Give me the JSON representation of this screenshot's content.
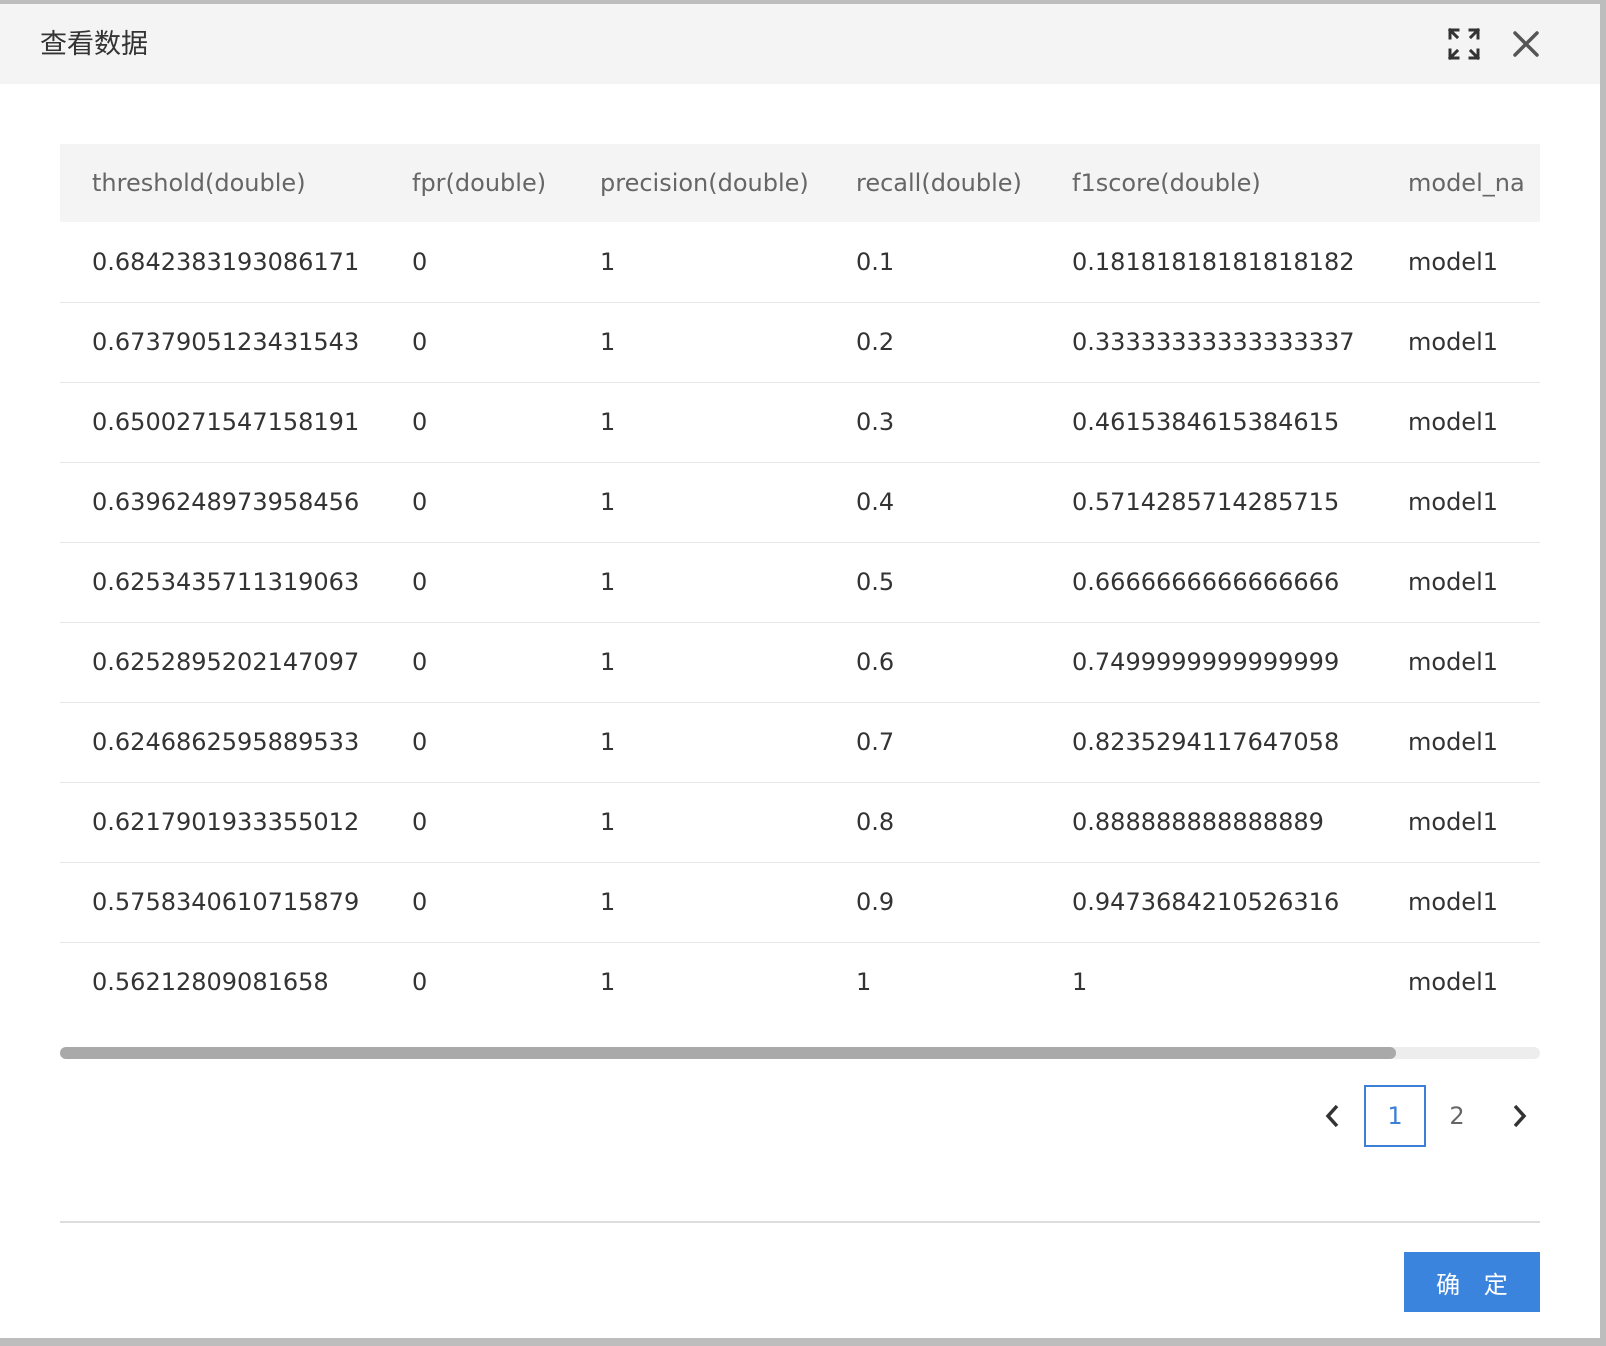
{
  "dialog": {
    "title": "查看数据",
    "confirm_label": "确 定"
  },
  "table": {
    "columns": [
      "threshold(double)",
      "fpr(double)",
      "precision(double)",
      "recall(double)",
      "f1score(double)",
      "model_na"
    ],
    "rows": [
      [
        "0.6842383193086171",
        "0",
        "1",
        "0.1",
        "0.18181818181818182",
        "model1"
      ],
      [
        "0.6737905123431543",
        "0",
        "1",
        "0.2",
        "0.33333333333333337",
        "model1"
      ],
      [
        "0.6500271547158191",
        "0",
        "1",
        "0.3",
        "0.4615384615384615",
        "model1"
      ],
      [
        "0.6396248973958456",
        "0",
        "1",
        "0.4",
        "0.5714285714285715",
        "model1"
      ],
      [
        "0.6253435711319063",
        "0",
        "1",
        "0.5",
        "0.6666666666666666",
        "model1"
      ],
      [
        "0.6252895202147097",
        "0",
        "1",
        "0.6",
        "0.7499999999999999",
        "model1"
      ],
      [
        "0.6246862595889533",
        "0",
        "1",
        "0.7",
        "0.8235294117647058",
        "model1"
      ],
      [
        "0.6217901933355012",
        "0",
        "1",
        "0.8",
        "0.888888888888889",
        "model1"
      ],
      [
        "0.5758340610715879",
        "0",
        "1",
        "0.9",
        "0.9473684210526316",
        "model1"
      ],
      [
        "0.56212809081658",
        "0",
        "1",
        "1",
        "1",
        "model1"
      ]
    ]
  },
  "pagination": {
    "pages": [
      "1",
      "2"
    ],
    "current": "1"
  },
  "colors": {
    "accent": "#3a84de",
    "header_bg": "#f4f4f4"
  }
}
